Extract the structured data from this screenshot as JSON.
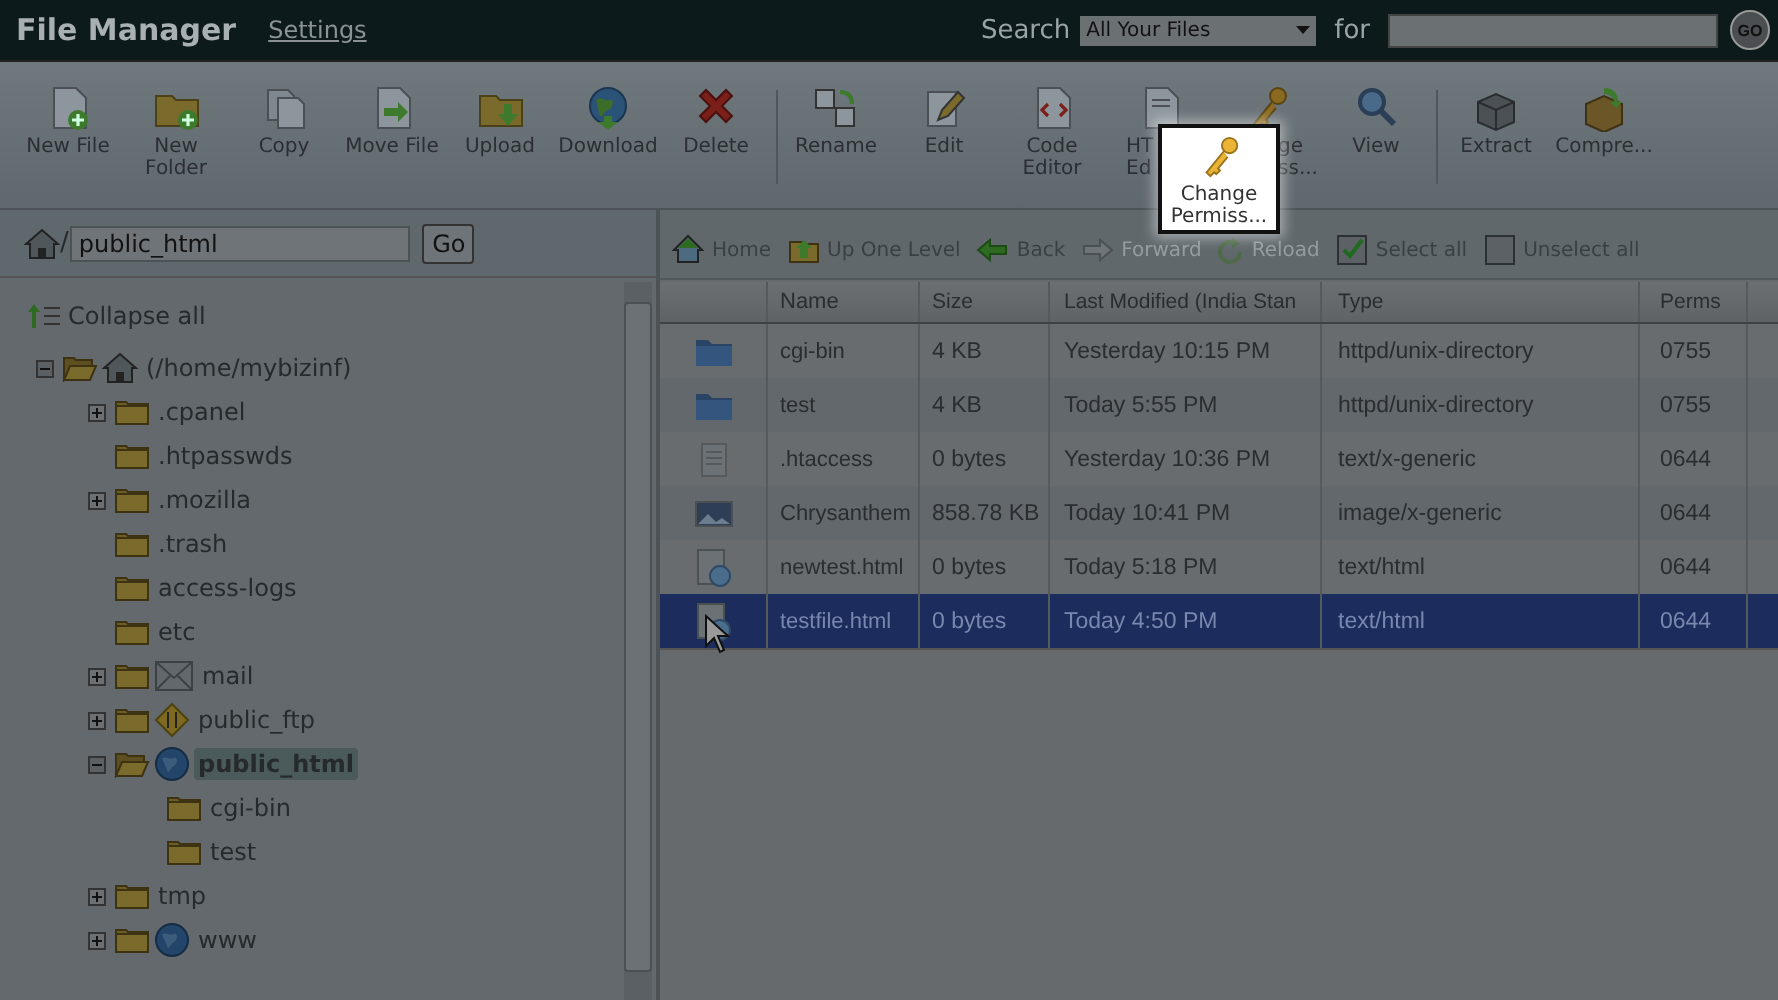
{
  "header": {
    "title": "File Manager",
    "settings_link": "Settings",
    "search_label": "Search",
    "search_scope": "All Your Files",
    "for_label": "for",
    "go_button": "GO"
  },
  "toolbar": [
    {
      "kind": "newfile",
      "label": "New File"
    },
    {
      "kind": "newfolder",
      "label": "New\nFolder"
    },
    {
      "kind": "copy",
      "label": "Copy"
    },
    {
      "kind": "move",
      "label": "Move File"
    },
    {
      "kind": "upload",
      "label": "Upload"
    },
    {
      "kind": "download",
      "label": "Download"
    },
    {
      "kind": "delete",
      "label": "Delete"
    },
    {
      "kind": "separator"
    },
    {
      "kind": "rename",
      "label": "Rename"
    },
    {
      "kind": "edit",
      "label": "Edit"
    },
    {
      "kind": "code",
      "label": "Code\nEditor"
    },
    {
      "kind": "html",
      "label": "HT\nEd"
    },
    {
      "kind": "perms",
      "label": "ge\nss..."
    },
    {
      "kind": "view",
      "label": "View"
    },
    {
      "kind": "separator"
    },
    {
      "kind": "extract",
      "label": "Extract"
    },
    {
      "kind": "compress",
      "label": "Compre..."
    }
  ],
  "spotlight": {
    "label": "Change\nPermiss..."
  },
  "address": {
    "separator": "/",
    "value": "public_html",
    "go_button": "Go"
  },
  "collapse_all": "Collapse all",
  "tree": [
    {
      "label": "(/home/mybizinf)",
      "kind": "home",
      "expanded": true,
      "selected": false,
      "children": [
        {
          "label": ".cpanel",
          "kind": "folder",
          "expanded": false,
          "selected": false
        },
        {
          "label": ".htpasswds",
          "kind": "folder",
          "selected": false
        },
        {
          "label": ".mozilla",
          "kind": "folder",
          "expanded": false,
          "selected": false
        },
        {
          "label": ".trash",
          "kind": "folder",
          "selected": false
        },
        {
          "label": "access-logs",
          "kind": "folder",
          "selected": false
        },
        {
          "label": "etc",
          "kind": "folder",
          "selected": false
        },
        {
          "label": "mail",
          "kind": "mail",
          "expanded": false,
          "selected": false
        },
        {
          "label": "public_ftp",
          "kind": "ftp",
          "expanded": false,
          "selected": false
        },
        {
          "label": "public_html",
          "kind": "web",
          "expanded": true,
          "selected": true,
          "children": [
            {
              "label": "cgi-bin",
              "kind": "folder",
              "selected": false
            },
            {
              "label": "test",
              "kind": "folder",
              "selected": false
            }
          ]
        },
        {
          "label": "tmp",
          "kind": "folder",
          "expanded": false,
          "selected": false
        },
        {
          "label": "www",
          "kind": "web",
          "expanded": false,
          "selected": false
        }
      ]
    }
  ],
  "nav": [
    {
      "kind": "home",
      "label": "Home",
      "disabled": false
    },
    {
      "kind": "up",
      "label": "Up One Level",
      "disabled": false
    },
    {
      "kind": "back",
      "label": "Back",
      "disabled": false
    },
    {
      "kind": "forward",
      "label": "Forward",
      "disabled": true
    },
    {
      "kind": "reload",
      "label": "Reload",
      "disabled": true
    },
    {
      "kind": "select",
      "label": "Select all",
      "disabled": false
    },
    {
      "kind": "unselect",
      "label": "Unselect all",
      "disabled": false
    }
  ],
  "table": {
    "columns": [
      "Name",
      "Size",
      "Last Modified (India Stan",
      "Type",
      "Perms"
    ],
    "rows": [
      {
        "kind": "folder",
        "selected": false,
        "cells": [
          "cgi-bin",
          "4 KB",
          "Yesterday 10:15 PM",
          "httpd/unix-directory",
          "0755"
        ]
      },
      {
        "kind": "folder",
        "selected": false,
        "cells": [
          "test",
          "4 KB",
          "Today 5:55 PM",
          "httpd/unix-directory",
          "0755"
        ]
      },
      {
        "kind": "text",
        "selected": false,
        "cells": [
          ".htaccess",
          "0 bytes",
          "Yesterday 10:36 PM",
          "text/x-generic",
          "0644"
        ]
      },
      {
        "kind": "image",
        "selected": false,
        "cells": [
          "Chrysanthem",
          "858.78 KB",
          "Today 10:41 PM",
          "image/x-generic",
          "0644"
        ]
      },
      {
        "kind": "html",
        "selected": false,
        "cells": [
          "newtest.html",
          "0 bytes",
          "Today 5:18 PM",
          "text/html",
          "0644"
        ]
      },
      {
        "kind": "html",
        "selected": true,
        "cells": [
          "testfile.html",
          "0 bytes",
          "Today 4:50 PM",
          "text/html",
          "0644"
        ]
      }
    ]
  }
}
